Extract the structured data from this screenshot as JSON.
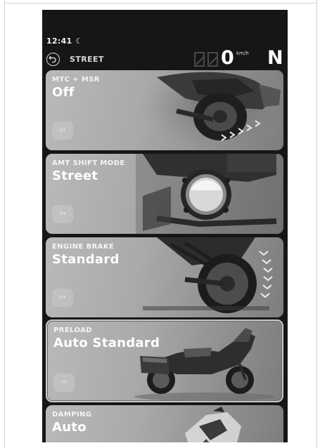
{
  "status_bar": {
    "time": "12:41",
    "icon": "moon-icon"
  },
  "header": {
    "back_icon": "back-arrow-icon",
    "mode": "STREET"
  },
  "speedometer": {
    "speed": "0",
    "unit": "km/h",
    "gear": "N"
  },
  "cards": [
    {
      "title": "MTC + MSR",
      "value": "Off",
      "control_icon": "left-right-arrows-icon"
    },
    {
      "title": "AMT SHIFT MODE",
      "value": "Street",
      "control_icon": "left-right-arrows-icon"
    },
    {
      "title": "ENGINE BRAKE",
      "value": "Standard",
      "control_icon": "left-right-arrows-icon"
    },
    {
      "title": "PRELOAD",
      "value": "Auto Standard",
      "selected": true,
      "control_icon": "left-right-arrows-icon"
    },
    {
      "title": "DAMPING",
      "value": "Auto"
    }
  ],
  "arrows_glyph": "‹›"
}
